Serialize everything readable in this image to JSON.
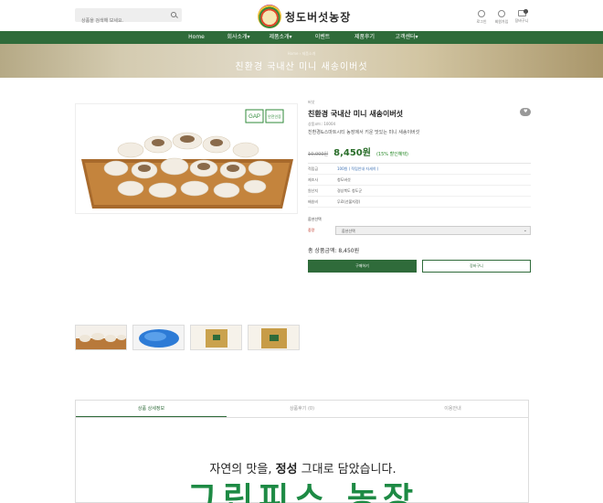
{
  "header": {
    "search_placeholder": "상품을 검색해 보세요.",
    "logo_text": "청도버섯농장",
    "util": [
      {
        "label": "로그인"
      },
      {
        "label": "회원가입"
      },
      {
        "label": "장바구니",
        "count": "0"
      }
    ]
  },
  "nav": {
    "items": [
      "Home",
      "회사소개▾",
      "제품소개▾",
      "이벤트",
      "제품후기",
      "고객센터▾"
    ]
  },
  "banner": {
    "breadcrumb": "Home › 제품소개",
    "title": "친환경 국내산 미니 새송이버섯"
  },
  "product": {
    "brand": "버섯",
    "title": "친환경 국내산 미니 새송이버섯",
    "code": "상품코드: 10004",
    "description": "친환경&스마트시티 농장에서 키운 맛있는 미니 새송이버섯",
    "old_price": "10,000원",
    "price": "8,450원",
    "discount": "(15% 할인혜택)",
    "specs": [
      {
        "k": "적립금",
        "v": "100원 ( 적립안내 자세히 )"
      },
      {
        "k": "제조사",
        "v": "청도버섯"
      },
      {
        "k": "원산지",
        "v": "경상북도 청도군"
      },
      {
        "k": "배송비",
        "v": "무료(선불지정)"
      }
    ],
    "option_title": "옵션선택",
    "option_label": "중량",
    "option_value": "옵션선택",
    "total": "총 상품금액: 8,450원",
    "buy_label": "구매하기",
    "cart_label": "장바구니",
    "gap_badge": "GAP",
    "safety_badge": "안전인증"
  },
  "detail": {
    "tabs": [
      "상품 상세정보",
      "상품후기 (0)",
      "이용안내"
    ],
    "headline_pre": "자연의 맛을, ",
    "headline_bold": "정성",
    "headline_post": " 그대로 담았습니다.",
    "big_text": "그린피스 농장"
  }
}
